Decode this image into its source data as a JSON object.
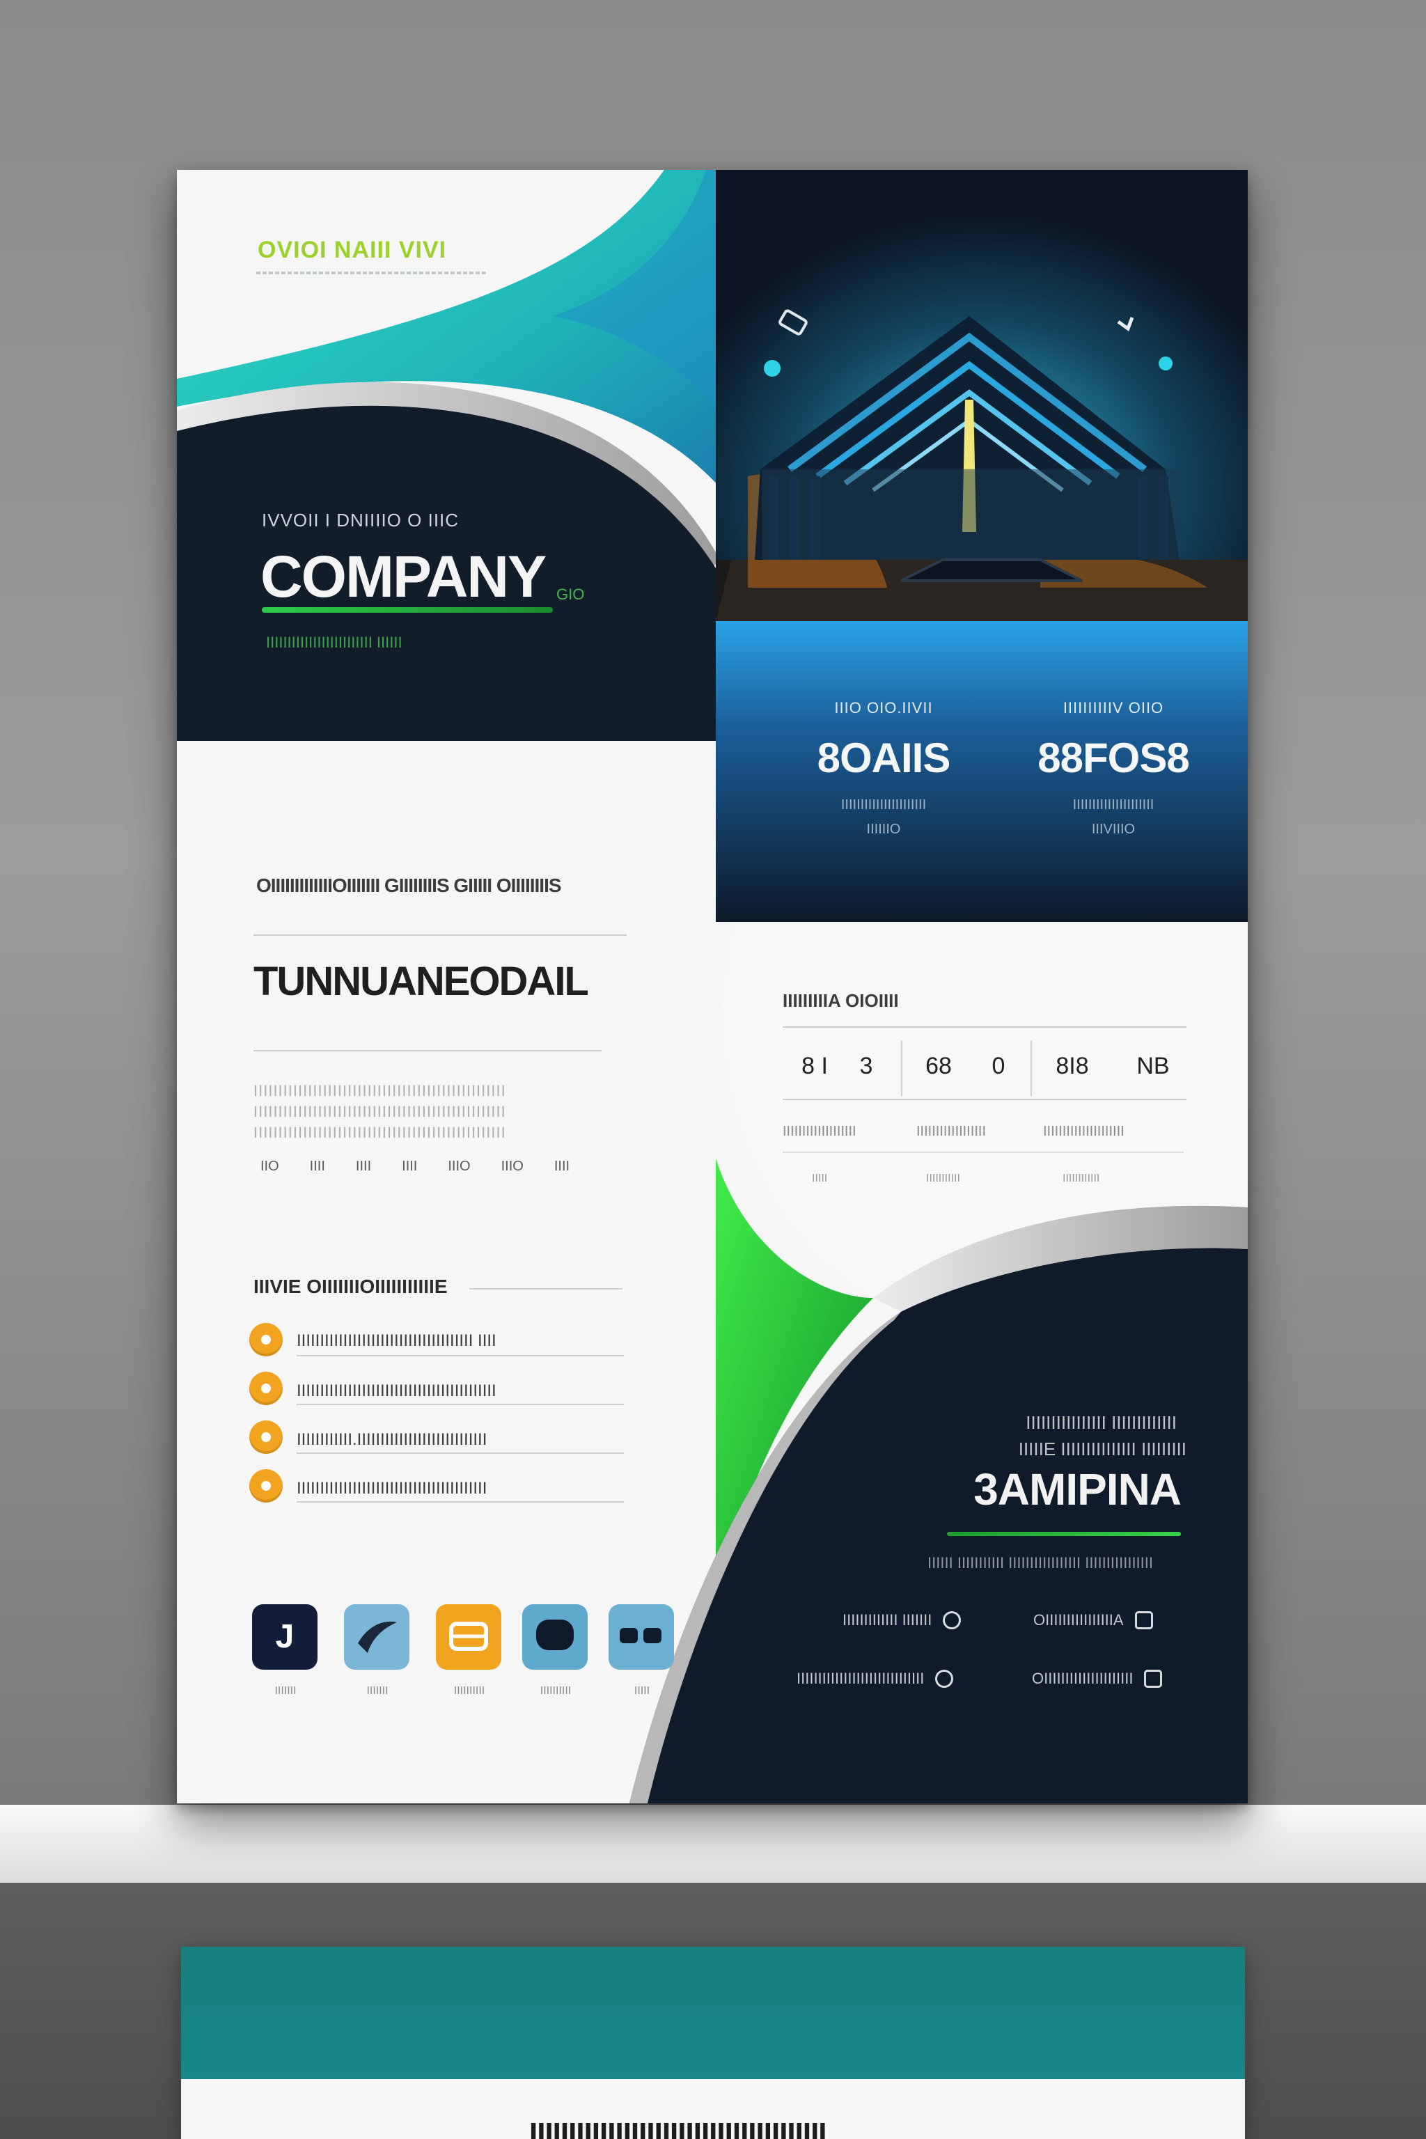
{
  "colors": {
    "navy": "#0f1a2a",
    "teal": "#22c7b5",
    "sky_blue": "#2ea4e4",
    "green": "#35d335",
    "orange": "#f2a31f",
    "card_teal": "#18807e"
  },
  "flyer": {
    "brand": "OVIOI NAIII VIVI",
    "dark_panel": {
      "kicker": "IVVOII I DNIIIIO O IIIC",
      "title": "COMPANY",
      "tag": "GIO",
      "subtitle": "IIIIIIIIIIIIIIIIIIIIIIIII IIIIII"
    },
    "stats": [
      {
        "label": "IIIO OIO.IIVII",
        "value": "8OAIIS",
        "sub1": "IIIIIIIIIIIIIIIIIIIIII",
        "sub2": "IIIIIIO"
      },
      {
        "label": "IIIIIIIIIIV OIIO",
        "value": "88FOS8",
        "sub1": "IIIIIIIIIIIIIIIIIIIII",
        "sub2": "IIIVIIIO"
      }
    ],
    "section": {
      "kicker": "OIIIIIIIIIIIIIOIIIIIII GIIIIIIIIS GIIIII OIIIIIIIIS",
      "title": "TUNNUANEODAIL",
      "filler": "IIIIIIIIIIIIIIIIIIIIIIIIIIIIIIIIIIIIIIIIIIIIIIIIIII",
      "marks": [
        "IIO",
        "IIII",
        "IIII",
        "IIII",
        "IIIO",
        "IIIO",
        "IIII"
      ]
    },
    "features": {
      "title": "IIIVIE OIIIIIIIOIIIIIIIIIIIE",
      "items": [
        "IIIIIIIIIIIIIIIIIIIIIIIIIIIIIIIIIIIIII IIII",
        "IIIIIIIIIIIIIIIIIIIIIIIIIIIIIIIIIIIIIIIIIII",
        "IIIIIIIIIIII.IIIIIIIIIIIIIIIIIIIIIIIIIIII",
        "IIIIIIIIIIIIIIIIIIIIIIIIIIIIIIIIIIIIIIIII"
      ]
    },
    "icons": [
      {
        "name": "app-icon-navy",
        "glyph": "J",
        "caption": "IIIIIII"
      },
      {
        "name": "app-icon-blue-swoosh",
        "glyph": "",
        "caption": "IIIIIII"
      },
      {
        "name": "app-icon-orange",
        "glyph": "",
        "caption": "IIIIIIIIII"
      },
      {
        "name": "app-icon-blue-chat",
        "glyph": "",
        "caption": "IIIIIIIIII"
      },
      {
        "name": "app-icon-blue-glasses",
        "glyph": "",
        "caption": "IIIII"
      }
    ],
    "table": {
      "title": "IIIIIIIIIA OIOIIII",
      "rows": [
        [
          "8 I",
          "3",
          "68",
          "0",
          "8I8",
          "NB"
        ]
      ],
      "captions": [
        "IIIIIIIIIIIIIIIIIII",
        "IIIIIIIIIIIIIIIIII",
        "IIIIIIIIIIIIIIIIIIIII"
      ],
      "footers": [
        "IIIII",
        "IIIIIIIIIII",
        "IIIIIIIIIIII"
      ]
    },
    "cta": {
      "kicker1": "IIIIIIIIIIIIIIII IIIIIIIIIIIII",
      "kicker2": "IIIIIE IIIIIIIIIIIIIII IIIIIIIII",
      "title": "3AMIPINA",
      "subtitle": "IIIIII IIIIIIIIIII IIIIIIIIIIIIIIIII IIIIIIIIIIIIIIII",
      "contacts": [
        "IIIIIIIIIIIII IIIIIII",
        "OIIIIIIIIIIIIIIIIA",
        "IIIIIIIIIIIIIIIIIIIIIIIIIIIIII",
        "OIIIIIIIIIIIIIIIIIIIII"
      ]
    }
  },
  "second_card": {
    "text": "IIIIIIIIIIIIIIIIIIIIIIIIIIIIIIIIIIIIII"
  }
}
